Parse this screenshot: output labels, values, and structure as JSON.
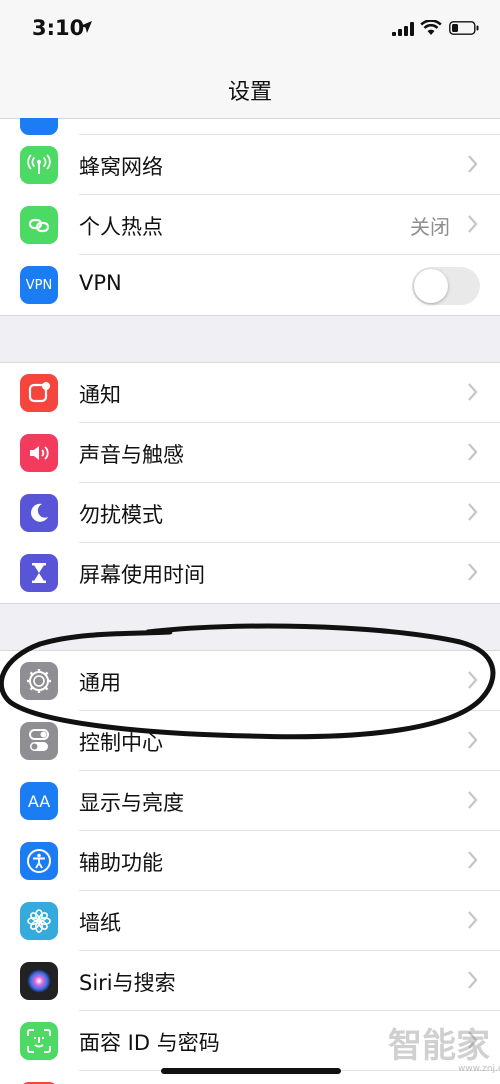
{
  "status_bar": {
    "time": "3:10"
  },
  "nav": {
    "title": "设置"
  },
  "groups": [
    {
      "rows": [
        {
          "label": "蜂窝网络",
          "icon": "cellular-antenna-icon",
          "color": "#4cd964"
        },
        {
          "label": "个人热点",
          "icon": "personal-hotspot-icon",
          "color": "#4cd964",
          "value": "关闭"
        },
        {
          "label": "VPN",
          "icon": "vpn-icon",
          "color": "#1c7cf4",
          "toggle_on": false,
          "icon_text": "VPN"
        }
      ]
    },
    {
      "rows": [
        {
          "label": "通知",
          "icon": "notifications-icon",
          "color": "#f5453c"
        },
        {
          "label": "声音与触感",
          "icon": "speaker-icon",
          "color": "#f33b5e"
        },
        {
          "label": "勿扰模式",
          "icon": "moon-icon",
          "color": "#5856d6"
        },
        {
          "label": "屏幕使用时间",
          "icon": "hourglass-icon",
          "color": "#5856d6"
        }
      ]
    },
    {
      "rows": [
        {
          "label": "通用",
          "icon": "gear-icon",
          "color": "#8e8e93"
        },
        {
          "label": "控制中心",
          "icon": "control-center-icon",
          "color": "#8e8e93"
        },
        {
          "label": "显示与亮度",
          "icon": "display-brightness-icon",
          "color": "#1c7cf4",
          "icon_text": "AA"
        },
        {
          "label": "辅助功能",
          "icon": "accessibility-icon",
          "color": "#1c7cf4"
        },
        {
          "label": "墙纸",
          "icon": "wallpaper-flower-icon",
          "color": "#35aadc"
        },
        {
          "label": "Siri与搜索",
          "icon": "siri-icon",
          "color": "#222222"
        },
        {
          "label": "面容 ID 与密码",
          "icon": "face-id-icon",
          "color": "#4cd964"
        }
      ]
    }
  ],
  "watermark": {
    "text": "智能家",
    "url": "www.znj.com"
  }
}
